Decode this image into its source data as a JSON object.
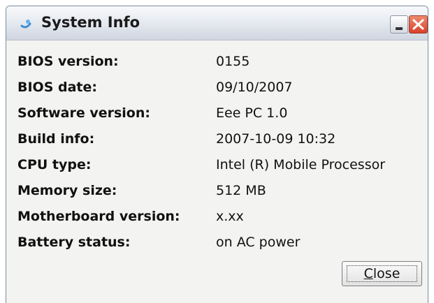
{
  "window": {
    "title": "System Info",
    "app_icon": "sysinfo-icon",
    "minimize_icon": "minimize-icon",
    "close_icon": "close-icon",
    "colors": {
      "title_close": "#d8412a",
      "background": "#f3f3f1"
    }
  },
  "info": {
    "rows": [
      {
        "label": "BIOS version:",
        "value": "0155"
      },
      {
        "label": "BIOS date:",
        "value": "09/10/2007"
      },
      {
        "label": "Software version:",
        "value": "Eee PC 1.0"
      },
      {
        "label": "Build info:",
        "value": "2007-10-09 10:32"
      },
      {
        "label": "CPU type:",
        "value": "Intel (R) Mobile Processor"
      },
      {
        "label": "Memory size:",
        "value": "512 MB"
      },
      {
        "label": "Motherboard version:",
        "value": "x.xx"
      },
      {
        "label": "Battery status:",
        "value": "on AC power"
      }
    ]
  },
  "buttons": {
    "close_mnemonic": "C",
    "close_rest": "lose"
  }
}
